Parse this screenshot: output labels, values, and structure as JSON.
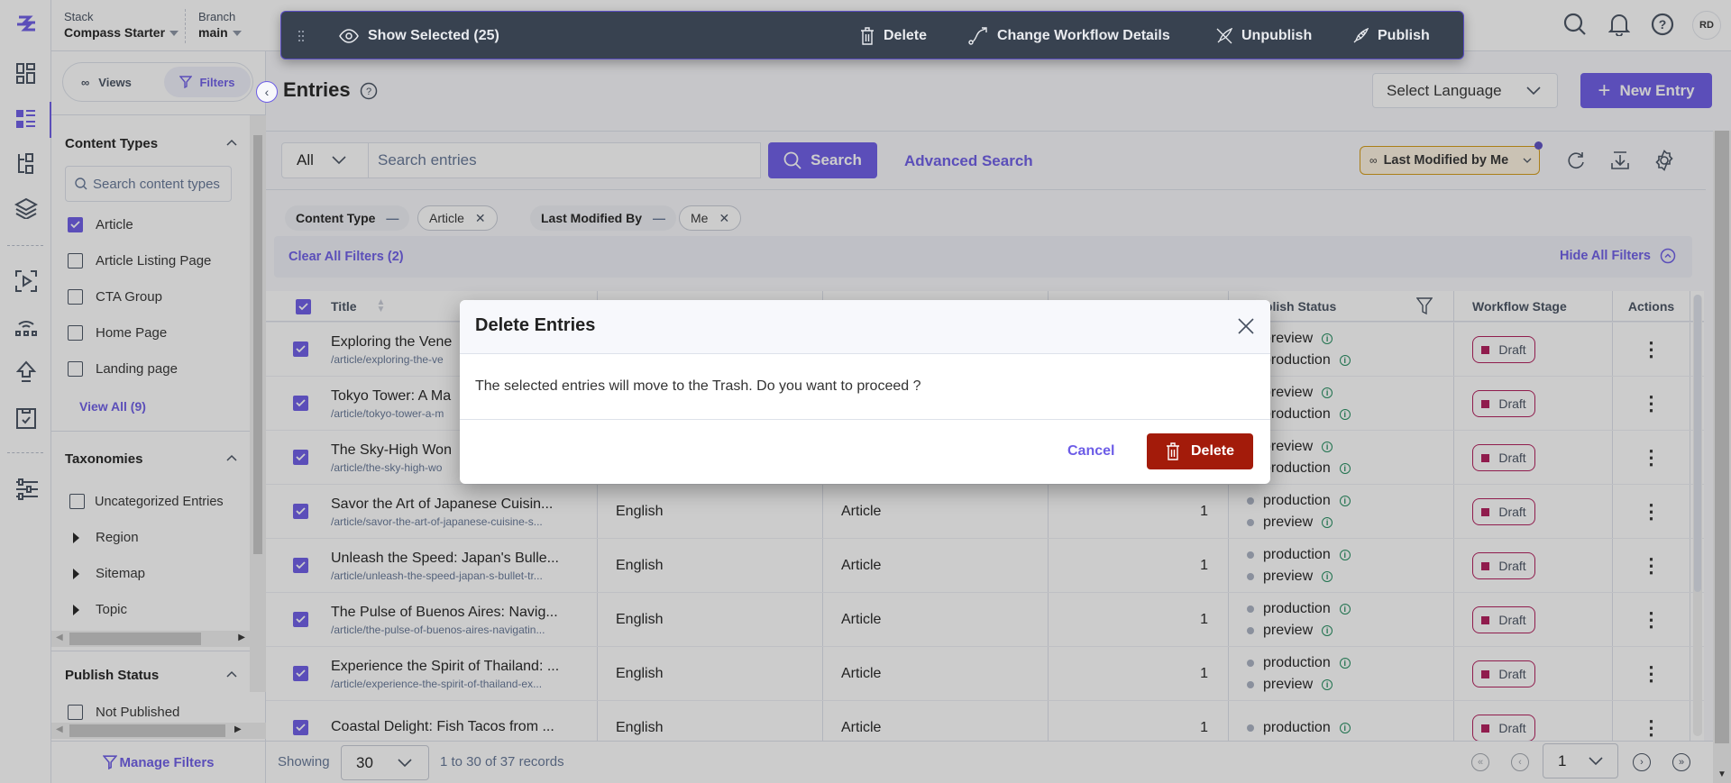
{
  "header": {
    "stack_label": "Stack",
    "stack_value": "Compass Starter",
    "branch_label": "Branch",
    "branch_value": "main",
    "avatar_initials": "RD"
  },
  "toolbar": {
    "show_selected": "Show Selected (25)",
    "delete": "Delete",
    "change_workflow": "Change Workflow Details",
    "unpublish": "Unpublish",
    "publish": "Publish"
  },
  "filter_panel": {
    "views_tab": "Views",
    "filters_tab": "Filters",
    "content_types": {
      "heading": "Content Types",
      "search_placeholder": "Search content types",
      "items": [
        {
          "label": "Article",
          "checked": true
        },
        {
          "label": "Article Listing Page",
          "checked": false
        },
        {
          "label": "CTA Group",
          "checked": false
        },
        {
          "label": "Home Page",
          "checked": false
        },
        {
          "label": "Landing page",
          "checked": false
        }
      ],
      "view_all": "View All (9)"
    },
    "taxonomies": {
      "heading": "Taxonomies",
      "uncategorized": "Uncategorized Entries",
      "groups": [
        "Region",
        "Sitemap",
        "Topic"
      ]
    },
    "publish_status": {
      "heading": "Publish Status",
      "items": [
        {
          "label": "Not Published",
          "checked": false
        }
      ]
    },
    "manage_filters": "Manage Filters"
  },
  "page": {
    "title": "Entries",
    "language_select": "Select Language",
    "new_entry": "New Entry"
  },
  "search": {
    "scope": "All",
    "placeholder": "Search entries",
    "button": "Search",
    "advanced": "Advanced Search",
    "saved_view": "Last Modified by Me"
  },
  "filters": {
    "chips": [
      {
        "key": "Content Type",
        "value": "Article"
      },
      {
        "key": "Last Modified By",
        "value": "Me"
      }
    ],
    "clear_all": "Clear All Filters (2)",
    "hide_all": "Hide All Filters"
  },
  "table": {
    "headers": {
      "title": "Title",
      "publish_status": "Publish Status",
      "workflow_stage": "Workflow Stage",
      "actions": "Actions"
    },
    "rows": [
      {
        "title": "Exploring the Vene",
        "url": "/article/exploring-the-ve",
        "language": "",
        "content_type": "",
        "version": "",
        "envs": [
          "preview",
          "production"
        ],
        "stage": "Draft"
      },
      {
        "title": "Tokyo Tower: A Ma",
        "url": "/article/tokyo-tower-a-m",
        "language": "",
        "content_type": "",
        "version": "",
        "envs": [
          "preview",
          "production"
        ],
        "stage": "Draft"
      },
      {
        "title": "The Sky-High Won",
        "url": "/article/the-sky-high-wo",
        "language": "",
        "content_type": "",
        "version": "",
        "envs": [
          "preview",
          "production"
        ],
        "stage": "Draft"
      },
      {
        "title": "Savor the Art of Japanese Cuisin...",
        "url": "/article/savor-the-art-of-japanese-cuisine-s...",
        "language": "English",
        "content_type": "Article",
        "version": "1",
        "envs": [
          "production",
          "preview"
        ],
        "stage": "Draft"
      },
      {
        "title": "Unleash the Speed: Japan's Bulle...",
        "url": "/article/unleash-the-speed-japan-s-bullet-tr...",
        "language": "English",
        "content_type": "Article",
        "version": "1",
        "envs": [
          "production",
          "preview"
        ],
        "stage": "Draft"
      },
      {
        "title": "The Pulse of Buenos Aires: Navig...",
        "url": "/article/the-pulse-of-buenos-aires-navigatin...",
        "language": "English",
        "content_type": "Article",
        "version": "1",
        "envs": [
          "production",
          "preview"
        ],
        "stage": "Draft"
      },
      {
        "title": "Experience the Spirit of Thailand: ...",
        "url": "/article/experience-the-spirit-of-thailand-ex...",
        "language": "English",
        "content_type": "Article",
        "version": "1",
        "envs": [
          "production",
          "preview"
        ],
        "stage": "Draft"
      },
      {
        "title": "Coastal Delight: Fish Tacos from ...",
        "url": "",
        "language": "English",
        "content_type": "Article",
        "version": "1",
        "envs": [
          "production"
        ],
        "stage": "Draft"
      }
    ]
  },
  "footer": {
    "showing_label": "Showing",
    "page_size": "30",
    "records": "1 to 30 of 37 records",
    "page": "1"
  },
  "modal": {
    "title": "Delete Entries",
    "message": "The selected entries will move to the Trash. Do you want to proceed ?",
    "cancel": "Cancel",
    "confirm": "Delete"
  },
  "colors": {
    "accent": "#6c5ce7",
    "danger": "#a31b0a",
    "draft": "#b11b5a",
    "toolbar_bg": "#384250"
  }
}
